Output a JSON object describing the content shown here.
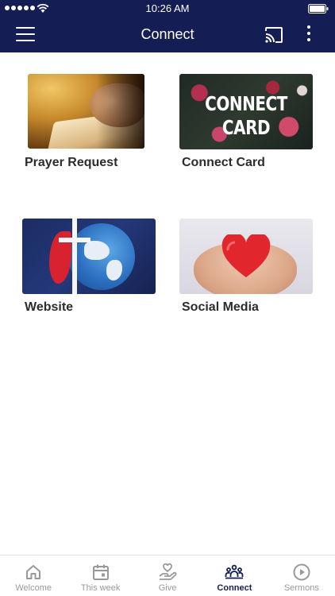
{
  "status_bar": {
    "time": "10:26 AM"
  },
  "header": {
    "title": "Connect"
  },
  "tiles": [
    {
      "label": "Prayer Request"
    },
    {
      "label": "Connect Card",
      "image_text": "CONNECT CARD"
    },
    {
      "label": "Website"
    },
    {
      "label": "Social Media"
    }
  ],
  "bottom_nav": [
    {
      "label": "Welcome",
      "icon": "home-icon"
    },
    {
      "label": "This week",
      "icon": "calendar-icon"
    },
    {
      "label": "Give",
      "icon": "hand-heart-icon"
    },
    {
      "label": "Connect",
      "icon": "group-icon",
      "active": true
    },
    {
      "label": "Sermons",
      "icon": "play-circle-icon"
    }
  ],
  "colors": {
    "primary": "#141e55",
    "inactive": "#999999",
    "label": "#2c2c2c"
  }
}
